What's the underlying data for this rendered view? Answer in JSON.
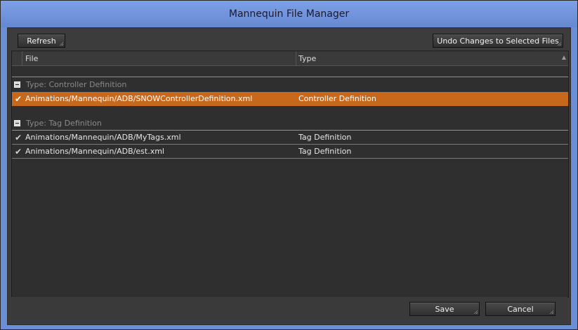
{
  "window": {
    "title": "Mannequin File Manager"
  },
  "toolbar": {
    "refresh_label": "Refresh",
    "undo_label": "Undo Changes to Selected Files"
  },
  "columns": {
    "file": "File",
    "type": "Type"
  },
  "groups": [
    {
      "label": "Type: Controller Definition",
      "rows": [
        {
          "file": "Animations/Mannequin/ADB/SNOWControllerDefinition.xml",
          "type": "Controller Definition",
          "selected": true
        }
      ]
    },
    {
      "label": "Type: Tag Definition",
      "rows": [
        {
          "file": "Animations/Mannequin/ADB/MyTags.xml",
          "type": "Tag Definition",
          "selected": false
        },
        {
          "file": "Animations/Mannequin/ADB/est.xml",
          "type": "Tag Definition",
          "selected": false
        }
      ]
    }
  ],
  "footer": {
    "save_label": "Save",
    "cancel_label": "Cancel"
  },
  "colors": {
    "titlebar": "#7ea0e6",
    "selected_row": "#c8681a",
    "panel": "#3c3c3c"
  },
  "icons": {
    "check": "checkmark-icon",
    "collapse": "minus-box-icon",
    "sort": "sort-ascending-icon"
  }
}
